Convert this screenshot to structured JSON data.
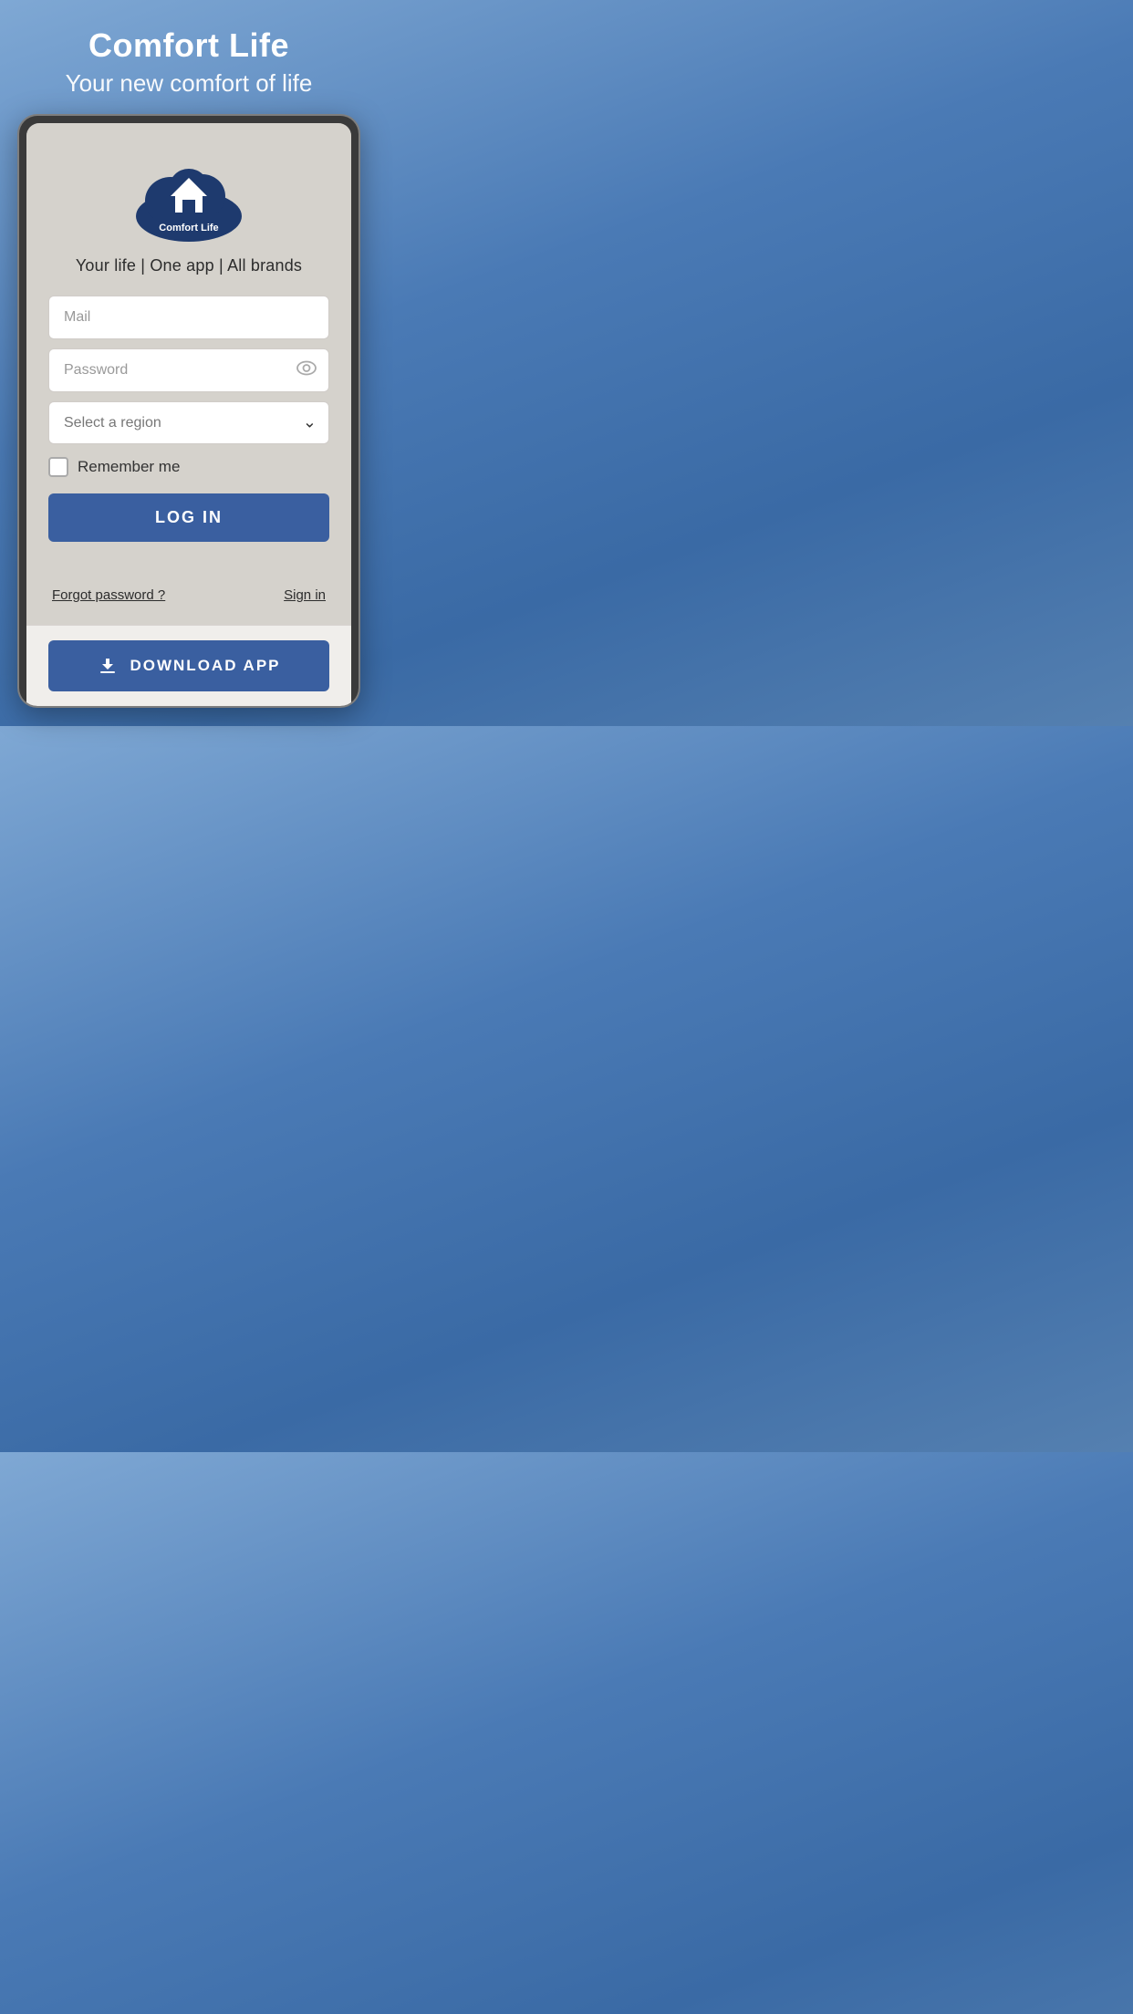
{
  "header": {
    "title": "Comfort Life",
    "subtitle": "Your new comfort of life"
  },
  "logo": {
    "text": "Comfort Life"
  },
  "tagline": "Your life | One app | All brands",
  "form": {
    "mail_placeholder": "Mail",
    "password_placeholder": "Password",
    "region_placeholder": "Select a region",
    "remember_label": "Remember me",
    "login_button": "LOG IN",
    "forgot_password": "Forgot password ?",
    "sign_in": "Sign in"
  },
  "download": {
    "button_label": "DOWNLOAD APP"
  }
}
